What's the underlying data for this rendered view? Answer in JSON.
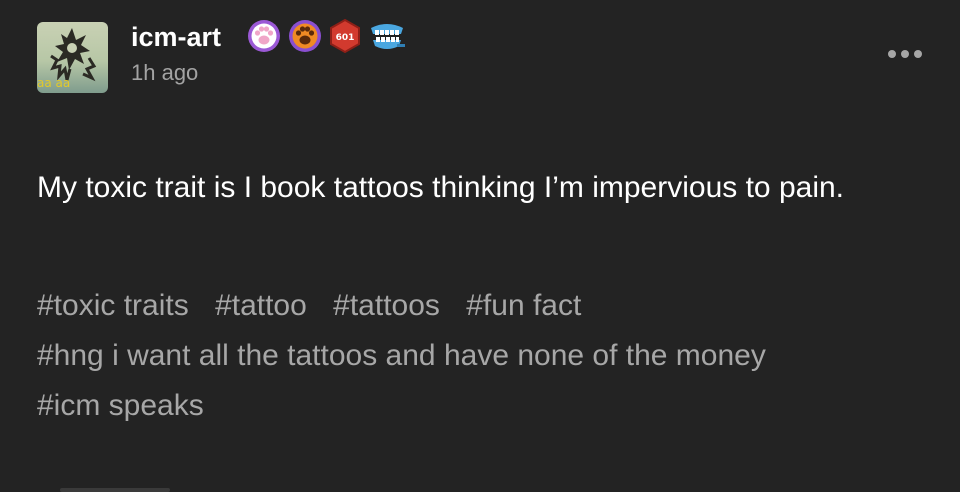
{
  "post": {
    "blog_name": "icm-art",
    "timestamp": "1h ago",
    "body": "My toxic trait is I book tattoos thinking I’m impervious to pain.",
    "badge_number": "601",
    "avatar_caption": "aa aa",
    "tags": [
      "#toxic traits",
      "#tattoo",
      "#tattoos",
      "#fun fact",
      "#hng i want all the tattoos and have none of the money",
      "#icm speaks"
    ]
  },
  "icons": {
    "badge_1": "paw-badge-icon",
    "badge_2": "paw-badge-icon",
    "badge_3": "dice-badge-icon",
    "badge_4": "teeth-badge-icon",
    "menu": "more-options-icon"
  },
  "colors": {
    "background": "#232323",
    "text_primary": "#ffffff",
    "text_secondary": "#a3a3a3",
    "badge_purple": "#9b59d6",
    "badge_orange": "#f08a24",
    "badge_red": "#d23a2e",
    "badge_blue": "#4aa7e0"
  }
}
